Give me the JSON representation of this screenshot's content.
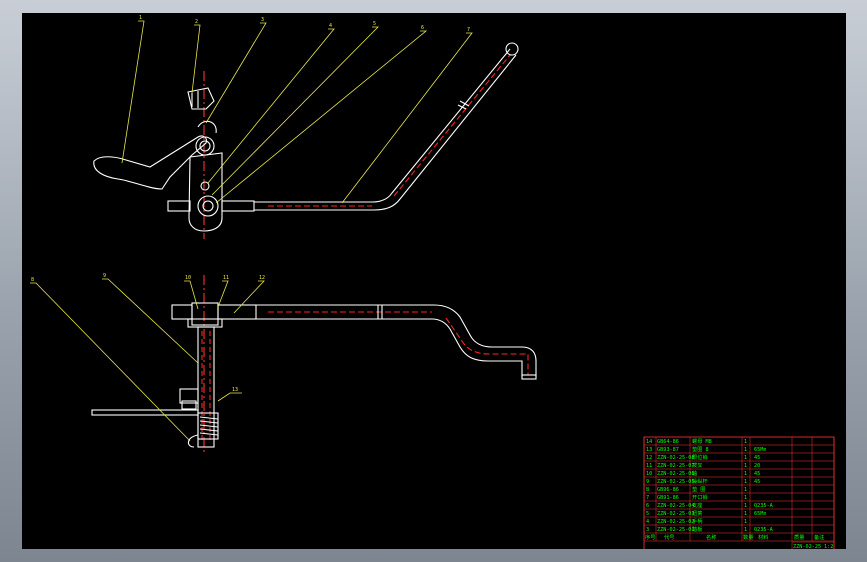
{
  "colors": {
    "background": "#000000",
    "outline": "#ffffff",
    "section": "#ff2222",
    "center": "#ff3333",
    "leader": "#e8e84a",
    "table_text": "#00ff00",
    "table_border": "#ff3333"
  },
  "balloons": {
    "top": [
      "1",
      "2",
      "3",
      "4",
      "5",
      "6",
      "7"
    ],
    "bottom": [
      "8",
      "9",
      "10",
      "11",
      "12"
    ],
    "side": "13"
  },
  "bom": {
    "rows": [
      {
        "no": "14",
        "code": "GB64-86",
        "name": "螺母 M8",
        "qty": "1",
        "mat": ""
      },
      {
        "no": "13",
        "code": "GB93-87",
        "name": "垫圈 8",
        "qty": "1",
        "mat": "65Mn"
      },
      {
        "no": "12",
        "code": "ZZN-02-25-08",
        "name": "限位销",
        "qty": "1",
        "mat": "45"
      },
      {
        "no": "11",
        "code": "ZZN-02-25-07",
        "name": "拨叉",
        "qty": "1",
        "mat": "20"
      },
      {
        "no": "10",
        "code": "ZZN-02-25-06",
        "name": "轴",
        "qty": "1",
        "mat": "45"
      },
      {
        "no": "9",
        "code": "ZZN-02-25-05",
        "name": "操纵杆",
        "qty": "1",
        "mat": "45"
      },
      {
        "no": "8",
        "code": "GB96-86",
        "name": "垫 圈",
        "qty": "1",
        "mat": ""
      },
      {
        "no": "7",
        "code": "GB91-86",
        "name": "开口销",
        "qty": "1",
        "mat": ""
      },
      {
        "no": "6",
        "code": "ZZN-02-25-04",
        "name": "支座",
        "qty": "1",
        "mat": "Q235-A"
      },
      {
        "no": "5",
        "code": "ZZN-02-25-03",
        "name": "扭簧",
        "qty": "1",
        "mat": "65Mn"
      },
      {
        "no": "4",
        "code": "ZZN-02-25-02",
        "name": "手柄",
        "qty": "1",
        "mat": ""
      },
      {
        "no": "3",
        "code": "ZZN-02-25-01",
        "name": "踏板",
        "qty": "1",
        "mat": "Q235-A"
      }
    ],
    "header": {
      "no": "序号",
      "code": "代号",
      "name": "名称",
      "qty": "数量",
      "mat": "材料",
      "mass": "质量",
      "note": "备注"
    },
    "title": {
      "drawing": "ZZN-02-25",
      "scale": "1:2"
    }
  }
}
